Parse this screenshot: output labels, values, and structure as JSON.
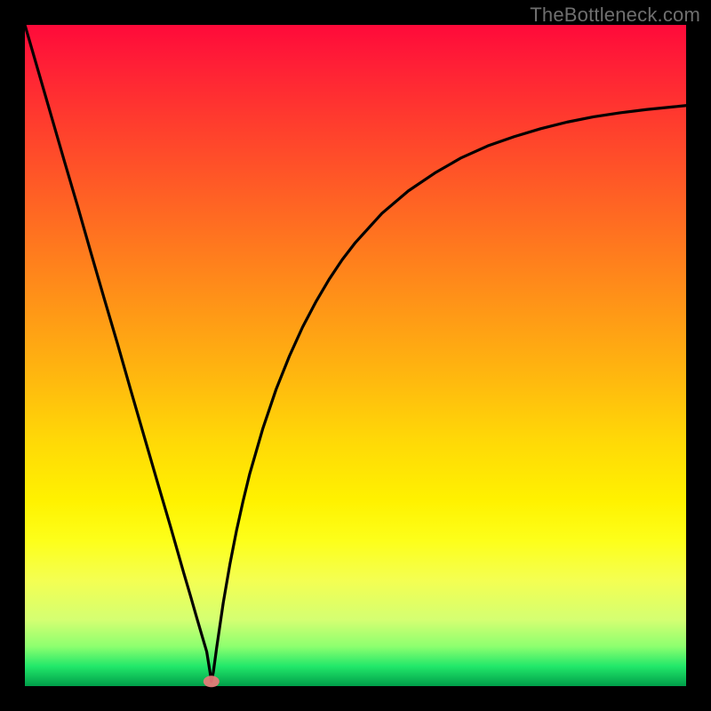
{
  "watermark": "TheBottleneck.com",
  "chart_data": {
    "type": "line",
    "title": "",
    "xlabel": "",
    "ylabel": "",
    "xlim": [
      0,
      100
    ],
    "ylim": [
      0,
      100
    ],
    "grid": false,
    "legend": "none",
    "marker": {
      "x": 28.2,
      "y": 0.7,
      "color": "#e97a7a"
    },
    "series": [
      {
        "name": "curve",
        "x": [
          0,
          2,
          4,
          6,
          8,
          10,
          12,
          14,
          16,
          18,
          20,
          22,
          24,
          25,
          26,
          27,
          27.5,
          28,
          28.2,
          28.5,
          29,
          30,
          31,
          32,
          33,
          34,
          36,
          38,
          40,
          42,
          44,
          46,
          48,
          50,
          54,
          58,
          62,
          66,
          70,
          74,
          78,
          82,
          86,
          90,
          94,
          98,
          100
        ],
        "values": [
          100,
          93.1,
          86.2,
          79.3,
          72.5,
          65.5,
          58.6,
          51.8,
          44.8,
          37.9,
          31,
          24.2,
          17.2,
          13.8,
          10.3,
          6.9,
          5.2,
          2.1,
          0.7,
          2.1,
          5.8,
          12.6,
          18.4,
          23.5,
          28,
          32.1,
          39,
          44.9,
          49.9,
          54.3,
          58.1,
          61.5,
          64.5,
          67.1,
          71.5,
          74.9,
          77.6,
          79.9,
          81.7,
          83.1,
          84.3,
          85.3,
          86.1,
          86.7,
          87.2,
          87.6,
          87.8
        ]
      }
    ]
  }
}
